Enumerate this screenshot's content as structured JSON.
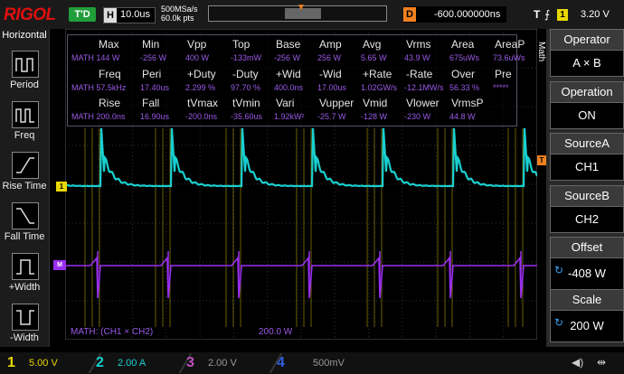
{
  "header": {
    "brand": "RIGOL",
    "trigger_status": "T'D",
    "horizontal_label": "H",
    "horizontal_scale": "10.0us",
    "sample_rate": "500MSa/s",
    "memory_depth": "60.0k pts",
    "delay_label": "D",
    "delay_value": "-600.000000ns",
    "trigger_label": "T",
    "trigger_source": "1",
    "trigger_level": "3.20 V"
  },
  "left_panel": {
    "title": "Horizontal",
    "items": [
      {
        "label": "Period"
      },
      {
        "label": "Freq"
      },
      {
        "label": "Rise Time"
      },
      {
        "label": "Fall Time"
      },
      {
        "label": "+Width"
      },
      {
        "label": "-Width"
      }
    ]
  },
  "measurements": {
    "rows": [
      {
        "headers": [
          "Max",
          "Min",
          "Vpp",
          "Top",
          "Base",
          "Amp",
          "Avg",
          "Vrms",
          "Area",
          "AreaP"
        ],
        "values": [
          "MATH 144 W",
          "-256 W",
          "400 W",
          "-133mW",
          "-256 W",
          "256 W",
          "5.65 W",
          "43.9 W",
          "675uWs",
          "73.6uWs"
        ]
      },
      {
        "headers": [
          "Freq",
          "Peri",
          "+Duty",
          "-Duty",
          "+Wid",
          "-Wid",
          "+Rate",
          "-Rate",
          "Over",
          "Pre"
        ],
        "values": [
          "MATH 57.5kHz",
          "17.40us",
          "2.299 %",
          "97.70 %",
          "400.0ns",
          "17.00us",
          "1.02GW/s",
          "-12.1MW/s",
          "56.33 %",
          "*****"
        ]
      },
      {
        "headers": [
          "Rise",
          "Fall",
          "tVmax",
          "tVmin",
          "Vari",
          "Vupper",
          "Vmid",
          "Vlower",
          "VrmsP",
          ""
        ],
        "values": [
          "MATH 200.0ns",
          "16.90us",
          "-200.0ns",
          "-35.60us",
          "1.92kW²",
          "-25.7 W",
          "-128 W",
          "-230 W",
          "44.8 W",
          ""
        ]
      }
    ]
  },
  "right_panel": {
    "menu_title": "Math",
    "items": [
      {
        "header": "Operator",
        "value": "A × B"
      },
      {
        "header": "Operation",
        "value": "ON"
      },
      {
        "header": "SourceA",
        "value": "CH1"
      },
      {
        "header": "SourceB",
        "value": "CH2"
      },
      {
        "header": "Offset",
        "value": "-408 W"
      },
      {
        "header": "Scale",
        "value": "200 W"
      }
    ]
  },
  "math_trace": {
    "label": "MATH: (CH1 × CH2)",
    "scale": "200.0 W"
  },
  "channels": [
    {
      "num": "1",
      "scale": "5.00 V",
      "color": "#e8d800"
    },
    {
      "num": "2",
      "scale": "2.00 A",
      "color": "#19d0d0"
    },
    {
      "num": "3",
      "scale": "2.00 V",
      "color": "#c050c0"
    },
    {
      "num": "4",
      "scale": "500mV",
      "color": "#3060e0"
    }
  ],
  "colors": {
    "ch1": "#e8d800",
    "ch2": "#19d0d0",
    "math": "#9a2ef0",
    "accent": "#f08020"
  }
}
